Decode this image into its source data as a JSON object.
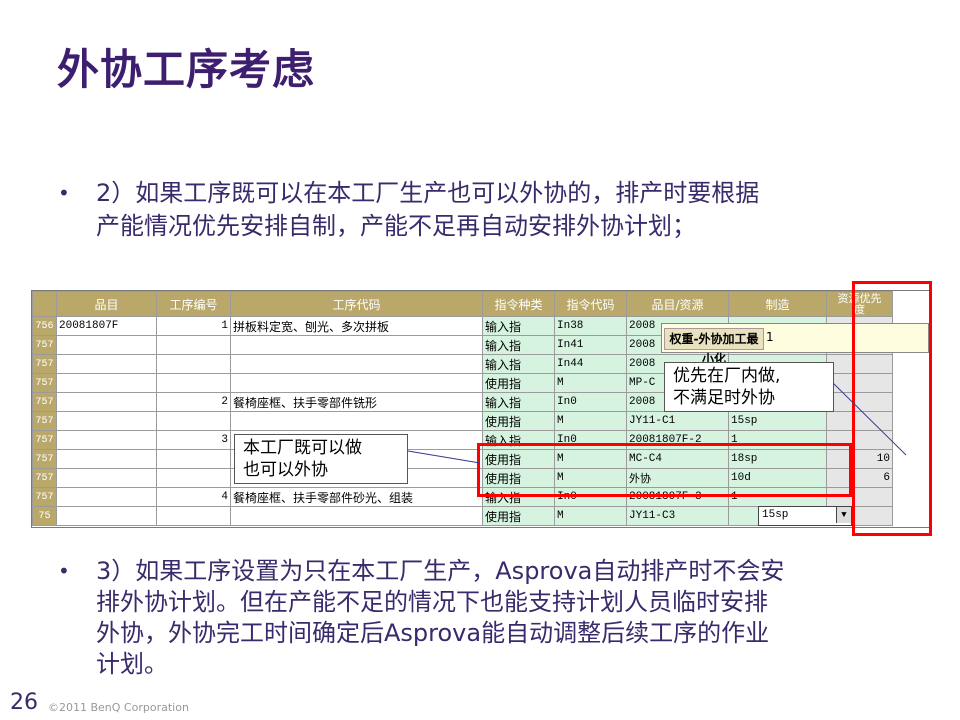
{
  "title": "外协工序考虑",
  "bullet1": {
    "line1": "2）如果工序既可以在本工厂生产也可以外协的，排产时要根据",
    "line2": "产能情况优先安排自制，产能不足再自动安排外协计划；"
  },
  "bullet2": {
    "line1": "3）如果工序设置为只在本工厂生产，Asprova自动排产时不会安",
    "line2": "排外协计划。但在产能不足的情况下也能支持计划人员临时安排",
    "line3": "外协，外协完工时间确定后Asprova能自动调整后续工序的作业",
    "line4": "计划。"
  },
  "bullet_symbol": "•",
  "grid": {
    "headers": {
      "item": "品目",
      "proc_no": "工序编号",
      "proc_code": "工序代码",
      "cmd_type": "指令种类",
      "cmd_code": "指令代码",
      "item_res": "品目/资源",
      "mfg": "制造",
      "priority_1": "资源优先",
      "priority_2": "度"
    },
    "rows": [
      {
        "rn": "756",
        "item": "20081807F",
        "no": "1",
        "proc": "拼板料定宽、刨光、多次拼板",
        "cmd": "输入指",
        "code": "In38",
        "res": "2008",
        "mfg": "",
        "pri": ""
      },
      {
        "rn": "757",
        "item": "",
        "no": "",
        "proc": "",
        "cmd": "输入指",
        "code": "In41",
        "res": "2008",
        "mfg": "",
        "pri": ""
      },
      {
        "rn": "757",
        "item": "",
        "no": "",
        "proc": "",
        "cmd": "输入指",
        "code": "In44",
        "res": "2008",
        "mfg": "",
        "pri": ""
      },
      {
        "rn": "757",
        "item": "",
        "no": "",
        "proc": "",
        "cmd": "使用指",
        "code": "M",
        "res": "MP-C",
        "mfg": "",
        "pri": ""
      },
      {
        "rn": "757",
        "item": "",
        "no": "2",
        "proc": "餐椅座框、扶手零部件铣形",
        "cmd": "输入指",
        "code": "In0",
        "res": "2008",
        "mfg": "",
        "pri": ""
      },
      {
        "rn": "757",
        "item": "",
        "no": "",
        "proc": "",
        "cmd": "使用指",
        "code": "M",
        "res": "JY11-C1",
        "mfg": "15sp",
        "pri": ""
      },
      {
        "rn": "757",
        "item": "",
        "no": "3",
        "proc": "",
        "cmd": "输入指",
        "code": "In0",
        "res": "20081807F-2",
        "mfg": "1",
        "pri": ""
      },
      {
        "rn": "757",
        "item": "",
        "no": "",
        "proc": "",
        "cmd": "使用指",
        "code": "M",
        "res": "MC-C4",
        "mfg": "18sp",
        "pri": "10"
      },
      {
        "rn": "757",
        "item": "",
        "no": "",
        "proc": "",
        "cmd": "使用指",
        "code": "M",
        "res": "外协",
        "mfg": "10d",
        "pri": "6"
      },
      {
        "rn": "757",
        "item": "",
        "no": "4",
        "proc": "餐椅座框、扶手零部件砂光、组装",
        "cmd": "输入指",
        "code": "In0",
        "res": "20081807F-3",
        "mfg": "1",
        "pri": ""
      },
      {
        "rn": "75",
        "item": "",
        "no": "",
        "proc": "",
        "cmd": "使用指",
        "code": "M",
        "res": "JY11-C3",
        "mfg": "",
        "pri": ""
      }
    ],
    "tooltip_label": "权重-外协加工最小化",
    "tooltip_value": "1",
    "dropdown_value": "15sp",
    "dropdown_arrow": "▼"
  },
  "callouts": {
    "inhouse_1": "优先在厂内做,",
    "inhouse_2": "不满足时外协",
    "either_1": "本工厂既可以做",
    "either_2": "也可以外协"
  },
  "footer": {
    "page": "26",
    "copyright": "©2011 BenQ Corporation"
  },
  "colors": {
    "title": "#3e1f6f",
    "header_bg": "#b9a86a",
    "cmd_bg": "#d6f3df",
    "highlight": "#ff0000"
  }
}
